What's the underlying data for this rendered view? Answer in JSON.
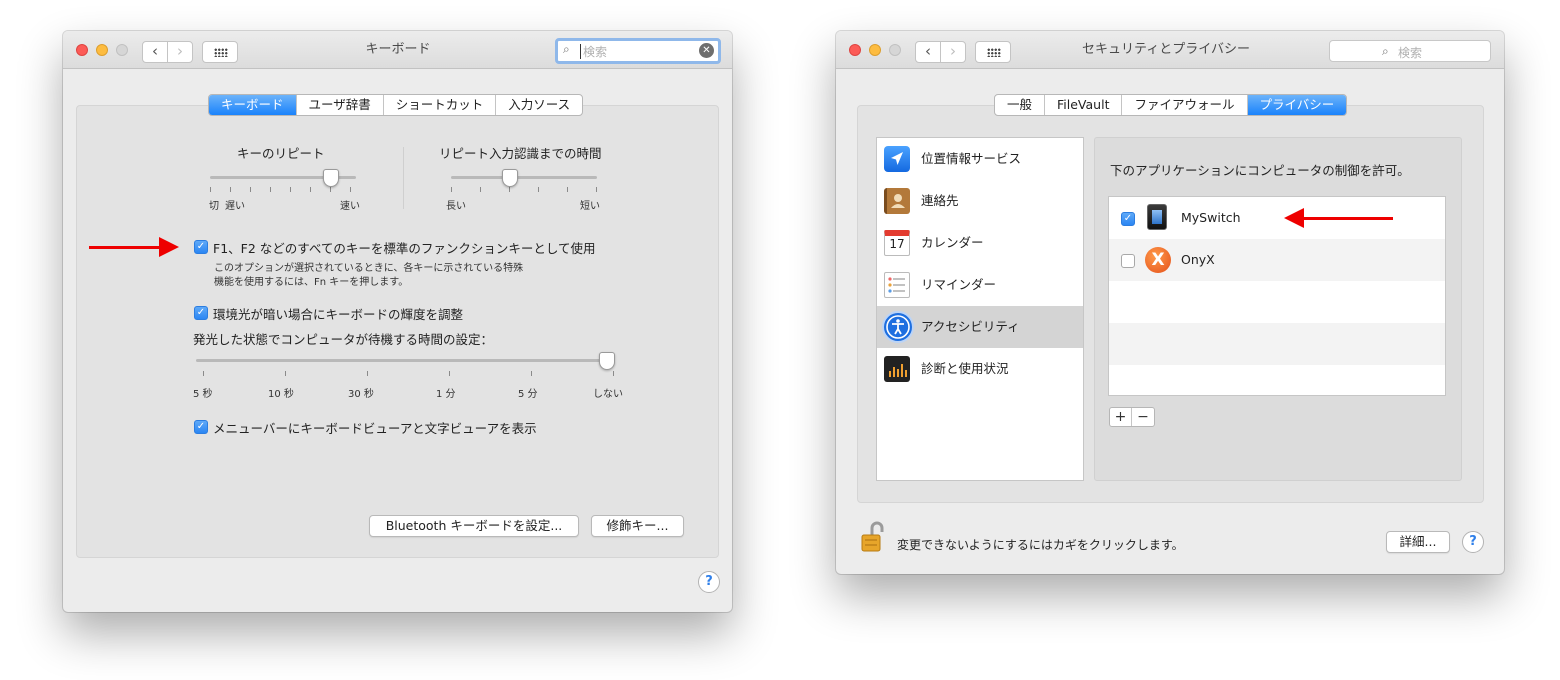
{
  "keyboard_window": {
    "title": "キーボード",
    "search_placeholder": "検索",
    "tabs": [
      "キーボード",
      "ユーザ辞書",
      "ショートカット",
      "入力ソース"
    ],
    "key_repeat": {
      "label": "キーのリピート",
      "min_labels": [
        "切",
        "遅い"
      ],
      "max_label": "速い",
      "level": 0.8
    },
    "delay_until_repeat": {
      "label": "リピート入力認識までの時間",
      "min_label": "長い",
      "max_label": "短い",
      "level": 0.4
    },
    "fn_keys": {
      "checked": true,
      "label": "F1、F2 などのすべてのキーを標準のファンクションキーとして使用",
      "description_line1": "このオプションが選択されているときに、各キーに示されている特殊",
      "description_line2": "機能を使用するには、Fn キーを押します。"
    },
    "adjust_brightness": {
      "checked": true,
      "label": "環境光が暗い場合にキーボードの輝度を調整"
    },
    "backlight_timeout": {
      "label": "発光した状態でコンピュータが待機する時間の設定：",
      "tick_labels": [
        "5 秒",
        "10 秒",
        "30 秒",
        "1 分",
        "5 分",
        "しない"
      ],
      "selected": "しない"
    },
    "show_viewers": {
      "checked": true,
      "label": "メニューバーにキーボードビューアと文字ビューアを表示"
    },
    "bluetooth_button": "Bluetooth キーボードを設定...",
    "modifier_button": "修飾キー...",
    "help": "?"
  },
  "security_window": {
    "title": "セキュリティとプライバシー",
    "search_placeholder": "検索",
    "tabs": [
      "一般",
      "FileVault",
      "ファイアウォール",
      "プライバシー"
    ],
    "selected_tab": "プライバシー",
    "sidebar": [
      {
        "label": "位置情報サービス",
        "icon": "location-arrow-icon"
      },
      {
        "label": "連絡先",
        "icon": "contacts-book-icon"
      },
      {
        "label": "カレンダー",
        "icon": "calendar-icon",
        "icon_text": "17"
      },
      {
        "label": "リマインダー",
        "icon": "reminders-icon"
      },
      {
        "label": "アクセシビリティ",
        "icon": "accessibility-icon",
        "selected": true
      },
      {
        "label": "診断と使用状況",
        "icon": "diagnostics-icon"
      }
    ],
    "heading": "下のアプリケーションにコンピュータの制御を許可。",
    "apps": [
      {
        "name": "MySwitch",
        "checked": true,
        "icon": "myswitch-app-icon"
      },
      {
        "name": "OnyX",
        "checked": false,
        "icon": "onyx-app-icon"
      }
    ],
    "add_button": "+",
    "remove_button": "−",
    "lock_text": "変更できないようにするにはカギをクリックします。",
    "details_button": "詳細...",
    "help": "?"
  },
  "colors": {
    "accent": "#1a82fb",
    "annotation_arrow": "#ee0000"
  }
}
